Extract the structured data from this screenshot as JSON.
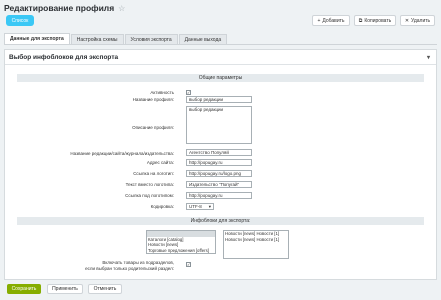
{
  "page": {
    "title": "Редактирование профиля"
  },
  "toolbar": {
    "back_label": "Список",
    "add_label": "Добавить",
    "copy_label": "Копировать",
    "delete_label": "Удалить"
  },
  "tabs": [
    {
      "label": "Данные для экспорта",
      "active": true
    },
    {
      "label": "Настройка схемы",
      "active": false
    },
    {
      "label": "Условия экспорта",
      "active": false
    },
    {
      "label": "Данные выхода",
      "active": false
    }
  ],
  "section": {
    "title": "Выбор инфоблоков для экспорта"
  },
  "general": {
    "header": "Общие параметры",
    "active_label": "Активность",
    "active_checked": true,
    "profile_name_label": "Название профиля:",
    "profile_name_value": "выбор редакции",
    "profile_desc_label": "Описание профиля:",
    "profile_desc_value": "выбор редакции",
    "editorial_label": "Название редакции/сайта/журнала/издательства:",
    "editorial_value": "Агентство Популяй",
    "site_url_label": "Адрес сайта:",
    "site_url_value": "http://popugay.ru",
    "logo_url_label": "Ссылка на логотип:",
    "logo_url_value": "http://popugay.ru/logo.png",
    "logo_text_label": "Текст вместо логотипа:",
    "logo_text_value": "Издательство \"Попугай\"",
    "logo_link_label": "Ссылка под логотипом:",
    "logo_link_value": "http://popugay.ru",
    "encoding_label": "Кодировка:",
    "encoding_value": "UTF-8"
  },
  "iblocks": {
    "header": "Инфоблоки для экспорта:",
    "left_list": [
      "",
      "Каталоги [catalog]",
      "Новости [news]",
      "Торговые предложения [offers]"
    ],
    "right_list": [
      "Новости [news] Новости [1]",
      "Новости [news] Новости [1]"
    ],
    "include_products_label_1": "Включать товары из подразделов,",
    "include_products_label_2": "если выбран только родительский раздел:",
    "include_products_checked": true
  },
  "footer": {
    "save_label": "Сохранить",
    "apply_label": "Применить",
    "cancel_label": "Отменить"
  },
  "colors": {
    "accent": "#3bc8f5",
    "save": "#86ad00"
  }
}
